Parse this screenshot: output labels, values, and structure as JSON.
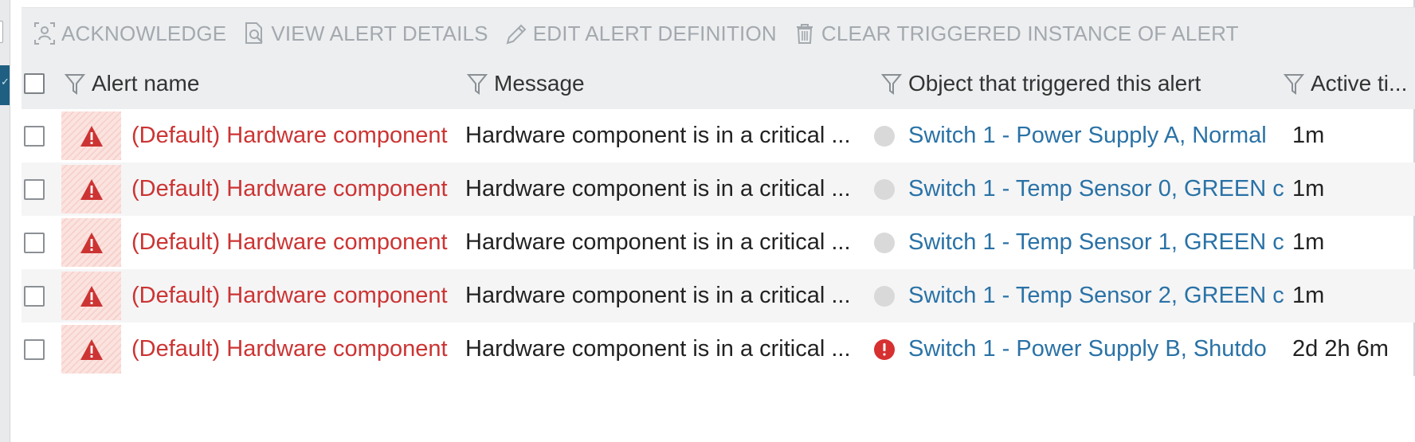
{
  "toolbar": {
    "buttons": [
      {
        "label": "ACKNOWLEDGE",
        "icon": "acknowledge-icon"
      },
      {
        "label": "VIEW ALERT DETAILS",
        "icon": "view-details-icon"
      },
      {
        "label": "EDIT ALERT DEFINITION",
        "icon": "pencil-icon"
      },
      {
        "label": "CLEAR TRIGGERED INSTANCE OF ALERT",
        "icon": "trash-icon"
      }
    ]
  },
  "table": {
    "columns": [
      {
        "label": "Alert name"
      },
      {
        "label": "Message"
      },
      {
        "label": "Object that triggered this alert"
      },
      {
        "label": "Active ti..."
      }
    ],
    "rows": [
      {
        "alert_name": "(Default) Hardware component",
        "message": "Hardware component is in a critical ...",
        "status": "unknown",
        "object": "Switch 1 - Power Supply A, Normal",
        "active_time": "1m"
      },
      {
        "alert_name": "(Default) Hardware component",
        "message": "Hardware component is in a critical ...",
        "status": "unknown",
        "object": "Switch 1 - Temp Sensor 0, GREEN c",
        "active_time": "1m"
      },
      {
        "alert_name": "(Default) Hardware component",
        "message": "Hardware component is in a critical ...",
        "status": "unknown",
        "object": "Switch 1 - Temp Sensor 1, GREEN c",
        "active_time": "1m"
      },
      {
        "alert_name": "(Default) Hardware component",
        "message": "Hardware component is in a critical ...",
        "status": "unknown",
        "object": "Switch 1 - Temp Sensor 2, GREEN c",
        "active_time": "1m"
      },
      {
        "alert_name": "(Default) Hardware component",
        "message": "Hardware component is in a critical ...",
        "status": "critical",
        "object": "Switch 1 - Power Supply B, Shutdo",
        "active_time": "2d 2h 6m"
      }
    ]
  },
  "colors": {
    "critical_red": "#cc3433",
    "link_blue": "#2a72a6",
    "toolbar_text": "#a4a9ae",
    "header_bg": "#eceef0",
    "unknown_gray": "#d9d9d9"
  }
}
